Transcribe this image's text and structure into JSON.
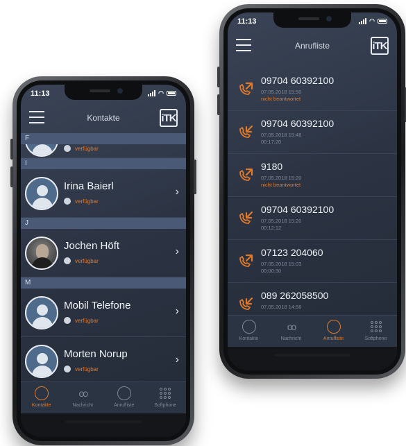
{
  "left_phone": {
    "status_time": "11:13",
    "title": "Kontakte",
    "logo_text": "iTK",
    "sections": [
      {
        "letter": "F",
        "contacts": [
          {
            "name": "",
            "status": "verfügbar",
            "avatar": "default",
            "partial": true
          }
        ]
      },
      {
        "letter": "I",
        "contacts": [
          {
            "name": "Irina Baierl",
            "status": "verfügbar",
            "avatar": "default"
          }
        ]
      },
      {
        "letter": "J",
        "contacts": [
          {
            "name": "Jochen Höft",
            "status": "verfügbar",
            "avatar": "photo"
          }
        ]
      },
      {
        "letter": "M",
        "contacts": [
          {
            "name": "Mobil Telefone",
            "status": "verfügbar",
            "avatar": "default"
          },
          {
            "name": "Morten Norup",
            "status": "verfügbar",
            "avatar": "default"
          }
        ]
      }
    ],
    "tabs": [
      {
        "label": "Kontakte",
        "icon": "contacts-icon",
        "active": true
      },
      {
        "label": "Nachricht",
        "icon": "voicemail-icon",
        "active": false
      },
      {
        "label": "Anrufliste",
        "icon": "clock-icon",
        "active": false
      },
      {
        "label": "Softphone",
        "icon": "dialpad-icon",
        "active": false
      }
    ]
  },
  "right_phone": {
    "status_time": "11:13",
    "title": "Anrufliste",
    "logo_text": "iTK",
    "calls": [
      {
        "number": "09704 60392100",
        "date": "07.05.2018 15:50",
        "detail": "nicht beantwortet",
        "direction": "outgoing",
        "missed": true
      },
      {
        "number": "09704 60392100",
        "date": "07.05.2018 15:48",
        "detail": "00:17:20",
        "direction": "incoming",
        "missed": false
      },
      {
        "number": "9180",
        "date": "07.05.2018 15:20",
        "detail": "nicht beantwortet",
        "direction": "outgoing",
        "missed": true
      },
      {
        "number": "09704 60392100",
        "date": "07.05.2018 15:20",
        "detail": "00:12:12",
        "direction": "incoming",
        "missed": false
      },
      {
        "number": "07123 204060",
        "date": "07.05.2018 15:03",
        "detail": "00:00:30",
        "direction": "outgoing",
        "missed": false
      },
      {
        "number": "089 262058500",
        "date": "07.05.2018 14:56",
        "detail": "",
        "direction": "incoming",
        "missed": false
      }
    ],
    "tabs": [
      {
        "label": "Kontakte",
        "icon": "contacts-icon",
        "active": false
      },
      {
        "label": "Nachricht",
        "icon": "voicemail-icon",
        "active": false
      },
      {
        "label": "Anrufliste",
        "icon": "clock-icon",
        "active": true
      },
      {
        "label": "Softphone",
        "icon": "dialpad-icon",
        "active": false
      }
    ]
  },
  "colors": {
    "accent": "#e07a2a",
    "background": "#2c3444",
    "section": "#4a5a76"
  }
}
